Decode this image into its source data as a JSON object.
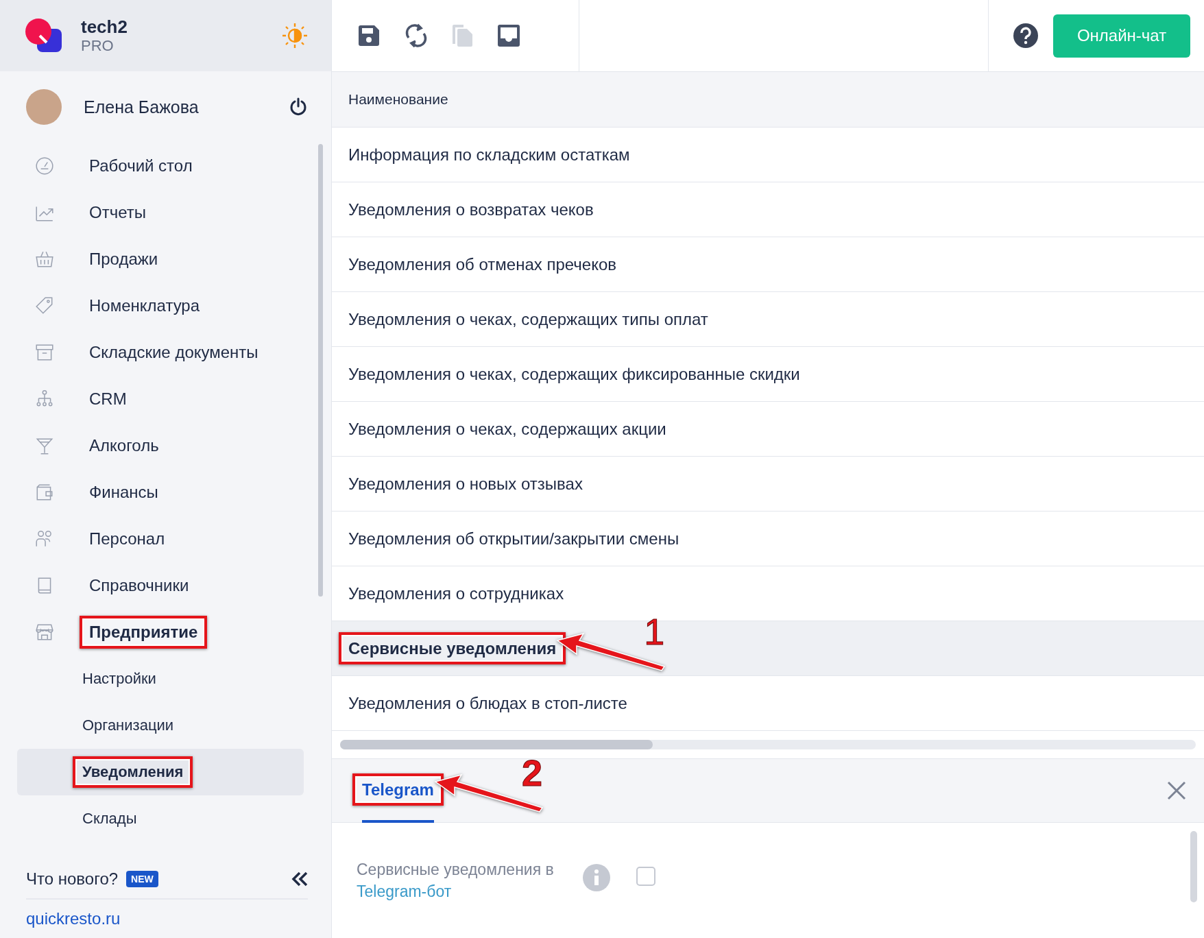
{
  "brand": {
    "name": "tech2",
    "plan": "PRO"
  },
  "user": {
    "name": "Елена Бажова"
  },
  "sidebar": {
    "nav": [
      {
        "label": "Рабочий стол",
        "expanded": false,
        "highlighted": false
      },
      {
        "label": "Отчеты",
        "expanded": false,
        "highlighted": false
      },
      {
        "label": "Продажи",
        "expanded": false,
        "highlighted": false
      },
      {
        "label": "Номенклатура",
        "expanded": false,
        "highlighted": false
      },
      {
        "label": "Складские документы",
        "expanded": false,
        "highlighted": false
      },
      {
        "label": "CRM",
        "expanded": false,
        "highlighted": false
      },
      {
        "label": "Алкоголь",
        "expanded": false,
        "highlighted": false
      },
      {
        "label": "Финансы",
        "expanded": false,
        "highlighted": false
      },
      {
        "label": "Персонал",
        "expanded": false,
        "highlighted": false
      },
      {
        "label": "Справочники",
        "expanded": false,
        "highlighted": false
      },
      {
        "label": "Предприятие",
        "expanded": true,
        "highlighted": true,
        "children": [
          {
            "label": "Настройки",
            "selected": false,
            "highlighted": false
          },
          {
            "label": "Организации",
            "selected": false,
            "highlighted": false
          },
          {
            "label": "Уведомления",
            "selected": true,
            "highlighted": true
          },
          {
            "label": "Склады",
            "selected": false,
            "highlighted": false
          }
        ]
      }
    ],
    "whats_new": "Что нового?",
    "new_badge": "NEW",
    "site_link": "quickresto.ru"
  },
  "toolbar": {
    "chat_button": "Онлайн-чат"
  },
  "table": {
    "columns": [
      "Наименование"
    ],
    "rows": [
      {
        "name": "Информация по складским остаткам",
        "selected": false,
        "highlighted": false
      },
      {
        "name": "Уведомления о возвратах чеков",
        "selected": false,
        "highlighted": false
      },
      {
        "name": "Уведомления об отменах пречеков",
        "selected": false,
        "highlighted": false
      },
      {
        "name": "Уведомления о чеках, содержащих типы оплат",
        "selected": false,
        "highlighted": false
      },
      {
        "name": "Уведомления о чеках, содержащих фиксированные скидки",
        "selected": false,
        "highlighted": false
      },
      {
        "name": "Уведомления о чеках, содержащих акции",
        "selected": false,
        "highlighted": false
      },
      {
        "name": "Уведомления о новых отзывах",
        "selected": false,
        "highlighted": false
      },
      {
        "name": "Уведомления об открытии/закрытии смены",
        "selected": false,
        "highlighted": false
      },
      {
        "name": "Уведомления о сотрудниках",
        "selected": false,
        "highlighted": false
      },
      {
        "name": "Сервисные уведомления",
        "selected": true,
        "highlighted": true,
        "annotation": "1"
      },
      {
        "name": "Уведомления о блюдах в стоп-листе",
        "selected": false,
        "highlighted": false
      }
    ]
  },
  "detail": {
    "tabs": [
      {
        "label": "Telegram",
        "selected": true,
        "highlighted": true,
        "annotation": "2"
      }
    ],
    "setting": {
      "label": "Сервисные уведомления в",
      "link": "Telegram-бот",
      "checked": false
    }
  }
}
